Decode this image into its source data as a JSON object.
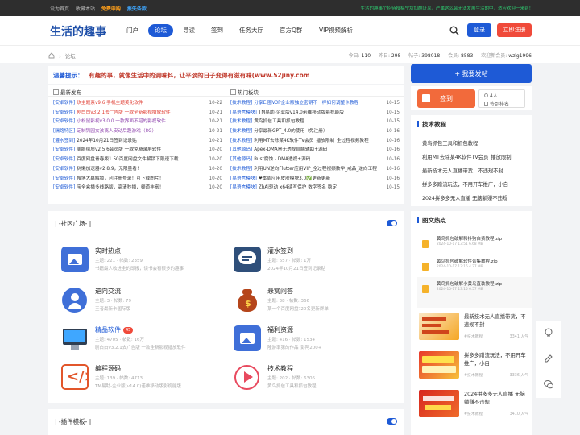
{
  "topbar": {
    "set_home": "设为首页",
    "bookmark": "收藏本站",
    "free_vip": "免费申购",
    "report": "报失条款",
    "notice": "生活的趣事个招待投稿宁坊加酷证享，严属这么会无法发展生活的中，适应欢迎一来到！"
  },
  "header": {
    "logo": "生活的趣事",
    "nav": [
      "门户",
      "论坛",
      "导读",
      "签到",
      "任务大厅",
      "官方Q群",
      "VIP视频解析"
    ],
    "active_nav": "论坛",
    "login": "登录",
    "register": "立即注册"
  },
  "crumb": {
    "home_label": "首页",
    "forum": "论坛"
  },
  "stats": {
    "today_label": "今日:",
    "today": "110",
    "yesterday_label": "昨日:",
    "yesterday": "298",
    "posts_label": "帖子:",
    "posts": "398018",
    "members_label": "会员:",
    "members": "8583",
    "welcome_label": "欢迎新会员:",
    "newest": "wzlg1996"
  },
  "notice": {
    "prefix": "温馨提示：",
    "body": "有趣的事，就像生活中的调味料，让平淡的日子变得有滋有味(www.52jiny.com"
  },
  "latest": {
    "title": "最新发布",
    "items": [
      {
        "tag": "[安卓软件]",
        "title": "玖主题素v9.6 手机主题美化软件",
        "date": "10-22",
        "color": "#e03c31"
      },
      {
        "tag": "[安卓软件]",
        "title": "剧白白v3.2.1去广告版 一款全新影视播放软件",
        "date": "10-21",
        "color": "#e03c31"
      },
      {
        "tag": "[安卓软件]",
        "title": "小松鼠影视v3.0.0 一款界面不错的影视软件",
        "date": "10-21",
        "color": "#8e44ad"
      },
      {
        "tag": "[隔路特区]",
        "title": "定制钩园女孩离人安动后趣游戏（8G）",
        "date": "10-21",
        "color": "#8e44ad"
      },
      {
        "tag": "[灌水签到]",
        "title": "2024年10月21日签到记录贴",
        "date": "10-21",
        "color": "#333333"
      },
      {
        "tag": "[安卓软件]",
        "title": "美眼绒质v2.5.6会员版 一款免费录屏软件",
        "date": "10-20",
        "color": "#333333"
      },
      {
        "tag": "[安卓软件]",
        "title": "百度网盘青春版1.50百度网盘文件解锁下限速下载",
        "date": "10-20",
        "color": "#333333"
      },
      {
        "tag": "[安卓软件]",
        "title": "树懒加速器v2.8.9，无限量看！",
        "date": "10-20",
        "color": "#333333"
      },
      {
        "tag": "[安卓软件]",
        "title": "搜博大赢解锁，利注册登录！可下载图片！",
        "date": "10-20",
        "color": "#333333"
      },
      {
        "tag": "[安卓软件]",
        "title": "宝全盒播多线路版，高清秒播，频道丰富！",
        "date": "10-20",
        "color": "#333333"
      }
    ]
  },
  "hot": {
    "title": "热门板块",
    "items": [
      {
        "tag": "[技术教程]",
        "title": "分享E.圈V3P企业版独立密钥不一样如何调整卡教程",
        "date": "10-15",
        "color": "#1e5ad6"
      },
      {
        "tag": "[易语言模块]",
        "title": "TM易助-企业版v14.0诺维移动版影视能版",
        "date": "10-15",
        "color": "#333333"
      },
      {
        "tag": "[技术教程]",
        "title": "黄鸟抓包工具和抓包教程",
        "date": "10-15",
        "color": "#333333"
      },
      {
        "tag": "[技术教程]",
        "title": "分享最新GPT_4.0的使用（免注册）",
        "date": "10-16",
        "color": "#333333"
      },
      {
        "tag": "[技术教程]",
        "title": "利用MT去除某4K软件TV会员_播放限制_全过程视频教程",
        "date": "10-16",
        "color": "#333333"
      },
      {
        "tag": "[其他源码]",
        "title": "Apex-DMA黑无透视自瞄辅助+源码",
        "date": "10-16",
        "color": "#333333"
      },
      {
        "tag": "[其他源码]",
        "title": "Rust腐蚀 - DMA透视+源码",
        "date": "10-16",
        "color": "#333333"
      },
      {
        "tag": "[技术教程]",
        "title": "利用UN逆向Flutter应用VIP_全过程视频教学_戒品_逆向工程",
        "date": "10-16",
        "color": "#333333"
      },
      {
        "tag": "[易语言模块]",
        "title": "❤本周应用皮肤模块3.0✅更新更新",
        "date": "10-16",
        "color": "#333333"
      },
      {
        "tag": "[易语言模块]",
        "title": "ZhAi驱动 x64读写保护 数字签名 稳定",
        "date": "10-15",
        "color": "#333333"
      }
    ]
  },
  "sidebar": {
    "post_button": "+ 我要发帖",
    "sign": {
      "label": "签到",
      "people": "4人",
      "rank": "签到排名"
    },
    "tech_title": "技术教程",
    "tech_items": [
      "黄鸟抓包工具和抓包教程",
      "利用MT去除某4K软件TV会员_播放限制",
      "最新技术无人直播带货，不违规不封",
      "拼多多蹭流玩法，不用开车推广，小白",
      "2024拼多多无人直播 无脑躺赚不违规"
    ],
    "pic_title": "图文热点",
    "files": [
      {
        "name": "黄鸟抓包破解和抖狗自费教程.zip",
        "date": "2024-10-17 13:51  6.68 MB"
      },
      {
        "name": "黄鸟抓包破解软件合集教程.zip",
        "date": "2024-10-17 13:16  4.27 MB"
      },
      {
        "name": "黄鸟抓包破解小黄鸟直装教程.zip",
        "date": "2024-10-17 13:15  6.57 MB"
      }
    ],
    "pics": [
      {
        "title": "最新技术无人直播带货，不违规不封",
        "cat": "#技术教程",
        "views": "3341 人气"
      },
      {
        "title": "拼多多蹭流玩法，不用开车推广，小白",
        "cat": "#技术教程",
        "views": "3336 人气"
      },
      {
        "title": "2024拼多多无人直播 无脑躺赚不违规",
        "cat": "#技术教程",
        "views": "3410 人气"
      }
    ]
  },
  "plaza": {
    "title": "| -社区广场- |",
    "categories": [
      {
        "name": "实时热点",
        "stats": "主题: 221 · 帖数: 2359",
        "desc": "书籍最人收进全的即报，读书会有很多的趣事",
        "badge": ""
      },
      {
        "name": "灌水签到",
        "stats": "主题: 657 · 帖数: 1万",
        "desc": "2024年10月21日签到记录贴",
        "badge": ""
      },
      {
        "name": "逆向交流",
        "stats": "主题: 3 · 帖数: 79",
        "desc": "王者最新卡国际版",
        "badge": ""
      },
      {
        "name": "悬赏问答",
        "stats": "主题: 38 · 帖数: 366",
        "desc": "某一个百度网盘?20名更新群单",
        "badge": ""
      },
      {
        "name": "精品软件",
        "stats": "主题: 4705 · 帖数: 16万",
        "desc": "剧白白v3.2.1去广告版 一款全新影视播放软件",
        "badge": "45"
      },
      {
        "name": "福利资源",
        "stats": "主题: 416 · 帖数: 1534",
        "desc": "隆游率第的作品_彭阿200+",
        "badge": ""
      },
      {
        "name": "编程源码",
        "stats": "主题: 139 · 帖数: 4713",
        "desc": "TM易助-企业版(v14.0)诺维移动版影视能版",
        "badge": ""
      },
      {
        "name": "技术教程",
        "stats": "主题: 202 · 帖数: 6306",
        "desc": "黄鸟抓包工具和抓包教程",
        "badge": ""
      }
    ]
  },
  "plugin": {
    "title": "| -插件模板- |"
  },
  "colors": {
    "primary": "#1e5ad6",
    "danger": "#f04a3a",
    "orange": "#f26a3b"
  }
}
